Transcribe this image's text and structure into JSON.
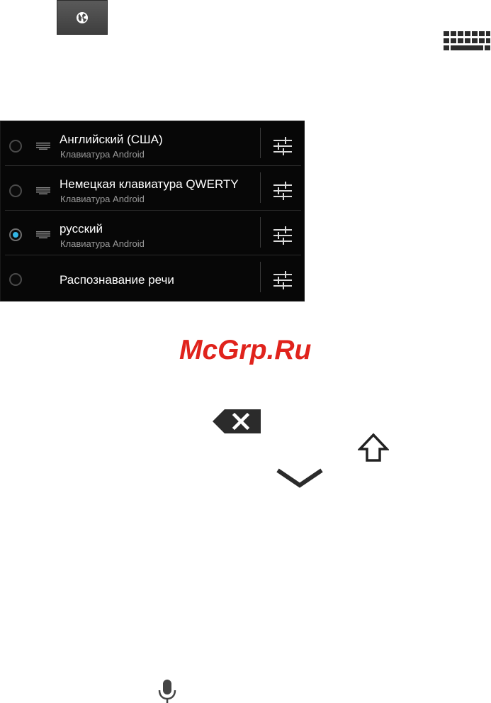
{
  "icons": {
    "globe": "globe-icon",
    "keyboard": "keyboard-icon",
    "backspace": "backspace-icon",
    "shift": "shift-arrow-icon",
    "hide_keyboard": "chevron-down-icon",
    "microphone": "microphone-icon",
    "settings": "sliders-settings-icon"
  },
  "input_methods": [
    {
      "title": "Английский (США)",
      "subtitle": "Клавиатура Android",
      "selected": false
    },
    {
      "title": "Немецкая клавиатура QWERTY",
      "subtitle": "Клавиатура Android",
      "selected": false
    },
    {
      "title": "русский",
      "subtitle": "Клавиатура Android",
      "selected": true
    },
    {
      "title": "Распознавание речи",
      "subtitle": "",
      "selected": false
    }
  ],
  "watermark": "McGrp.Ru",
  "colors": {
    "panel_bg": "#070707",
    "selected_radio": "#33b5e5",
    "watermark": "#e0231c",
    "icon_dark": "#2b2b2b"
  }
}
